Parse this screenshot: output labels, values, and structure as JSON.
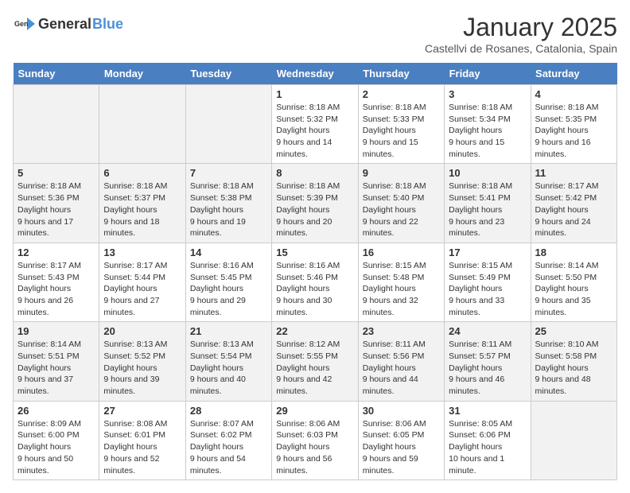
{
  "header": {
    "logo_general": "General",
    "logo_blue": "Blue",
    "title": "January 2025",
    "subtitle": "Castellvi de Rosanes, Catalonia, Spain"
  },
  "weekdays": [
    "Sunday",
    "Monday",
    "Tuesday",
    "Wednesday",
    "Thursday",
    "Friday",
    "Saturday"
  ],
  "weeks": [
    [
      {
        "day": null
      },
      {
        "day": null
      },
      {
        "day": null
      },
      {
        "day": "1",
        "sunrise": "8:18 AM",
        "sunset": "5:32 PM",
        "daylight": "9 hours and 14 minutes."
      },
      {
        "day": "2",
        "sunrise": "8:18 AM",
        "sunset": "5:33 PM",
        "daylight": "9 hours and 15 minutes."
      },
      {
        "day": "3",
        "sunrise": "8:18 AM",
        "sunset": "5:34 PM",
        "daylight": "9 hours and 15 minutes."
      },
      {
        "day": "4",
        "sunrise": "8:18 AM",
        "sunset": "5:35 PM",
        "daylight": "9 hours and 16 minutes."
      }
    ],
    [
      {
        "day": "5",
        "sunrise": "8:18 AM",
        "sunset": "5:36 PM",
        "daylight": "9 hours and 17 minutes."
      },
      {
        "day": "6",
        "sunrise": "8:18 AM",
        "sunset": "5:37 PM",
        "daylight": "9 hours and 18 minutes."
      },
      {
        "day": "7",
        "sunrise": "8:18 AM",
        "sunset": "5:38 PM",
        "daylight": "9 hours and 19 minutes."
      },
      {
        "day": "8",
        "sunrise": "8:18 AM",
        "sunset": "5:39 PM",
        "daylight": "9 hours and 20 minutes."
      },
      {
        "day": "9",
        "sunrise": "8:18 AM",
        "sunset": "5:40 PM",
        "daylight": "9 hours and 22 minutes."
      },
      {
        "day": "10",
        "sunrise": "8:18 AM",
        "sunset": "5:41 PM",
        "daylight": "9 hours and 23 minutes."
      },
      {
        "day": "11",
        "sunrise": "8:17 AM",
        "sunset": "5:42 PM",
        "daylight": "9 hours and 24 minutes."
      }
    ],
    [
      {
        "day": "12",
        "sunrise": "8:17 AM",
        "sunset": "5:43 PM",
        "daylight": "9 hours and 26 minutes."
      },
      {
        "day": "13",
        "sunrise": "8:17 AM",
        "sunset": "5:44 PM",
        "daylight": "9 hours and 27 minutes."
      },
      {
        "day": "14",
        "sunrise": "8:16 AM",
        "sunset": "5:45 PM",
        "daylight": "9 hours and 29 minutes."
      },
      {
        "day": "15",
        "sunrise": "8:16 AM",
        "sunset": "5:46 PM",
        "daylight": "9 hours and 30 minutes."
      },
      {
        "day": "16",
        "sunrise": "8:15 AM",
        "sunset": "5:48 PM",
        "daylight": "9 hours and 32 minutes."
      },
      {
        "day": "17",
        "sunrise": "8:15 AM",
        "sunset": "5:49 PM",
        "daylight": "9 hours and 33 minutes."
      },
      {
        "day": "18",
        "sunrise": "8:14 AM",
        "sunset": "5:50 PM",
        "daylight": "9 hours and 35 minutes."
      }
    ],
    [
      {
        "day": "19",
        "sunrise": "8:14 AM",
        "sunset": "5:51 PM",
        "daylight": "9 hours and 37 minutes."
      },
      {
        "day": "20",
        "sunrise": "8:13 AM",
        "sunset": "5:52 PM",
        "daylight": "9 hours and 39 minutes."
      },
      {
        "day": "21",
        "sunrise": "8:13 AM",
        "sunset": "5:54 PM",
        "daylight": "9 hours and 40 minutes."
      },
      {
        "day": "22",
        "sunrise": "8:12 AM",
        "sunset": "5:55 PM",
        "daylight": "9 hours and 42 minutes."
      },
      {
        "day": "23",
        "sunrise": "8:11 AM",
        "sunset": "5:56 PM",
        "daylight": "9 hours and 44 minutes."
      },
      {
        "day": "24",
        "sunrise": "8:11 AM",
        "sunset": "5:57 PM",
        "daylight": "9 hours and 46 minutes."
      },
      {
        "day": "25",
        "sunrise": "8:10 AM",
        "sunset": "5:58 PM",
        "daylight": "9 hours and 48 minutes."
      }
    ],
    [
      {
        "day": "26",
        "sunrise": "8:09 AM",
        "sunset": "6:00 PM",
        "daylight": "9 hours and 50 minutes."
      },
      {
        "day": "27",
        "sunrise": "8:08 AM",
        "sunset": "6:01 PM",
        "daylight": "9 hours and 52 minutes."
      },
      {
        "day": "28",
        "sunrise": "8:07 AM",
        "sunset": "6:02 PM",
        "daylight": "9 hours and 54 minutes."
      },
      {
        "day": "29",
        "sunrise": "8:06 AM",
        "sunset": "6:03 PM",
        "daylight": "9 hours and 56 minutes."
      },
      {
        "day": "30",
        "sunrise": "8:06 AM",
        "sunset": "6:05 PM",
        "daylight": "9 hours and 59 minutes."
      },
      {
        "day": "31",
        "sunrise": "8:05 AM",
        "sunset": "6:06 PM",
        "daylight": "10 hours and 1 minute."
      },
      {
        "day": null
      }
    ]
  ]
}
